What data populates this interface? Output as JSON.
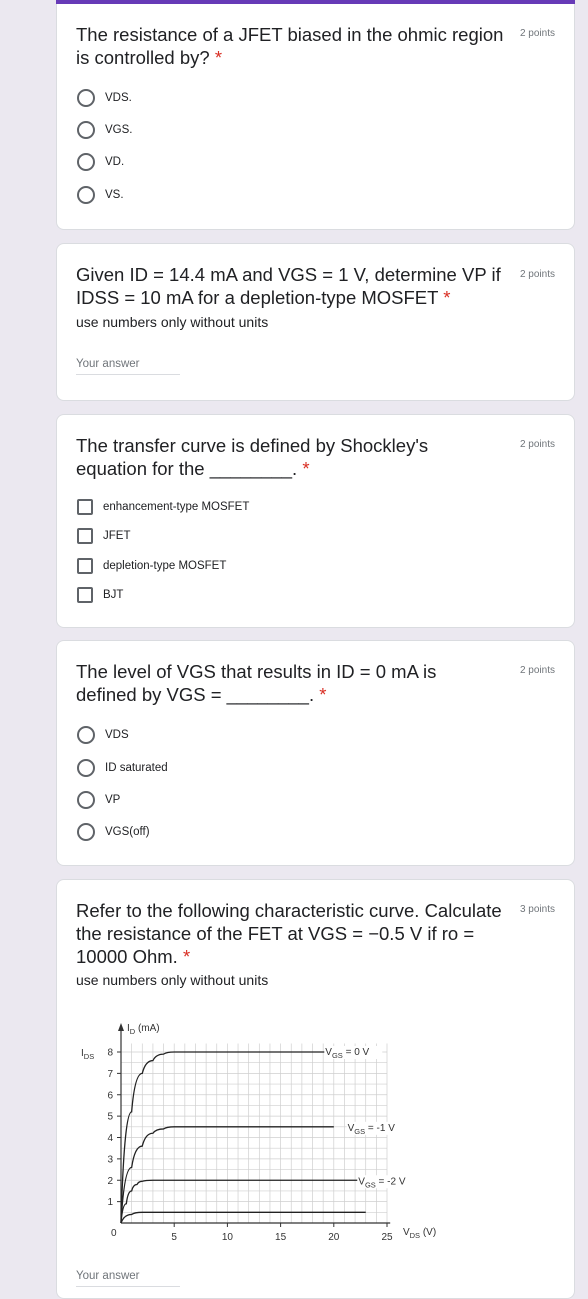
{
  "questions": [
    {
      "title": "The resistance of a JFET biased in the ohmic region is controlled by?",
      "required_mark": "*",
      "points": "2 points",
      "options": [
        "VDS.",
        "VGS.",
        "VD.",
        "VS."
      ]
    },
    {
      "title": "Given ID = 14.4 mA and VGS = 1 V, determine VP if IDSS = 10 mA for a depletion-type MOSFET",
      "required_mark": "*",
      "points": "2 points",
      "description": "use numbers only without units",
      "answer_placeholder": "Your answer"
    },
    {
      "title": "The transfer curve is defined by Shockley's equation for the ________.",
      "required_mark": "*",
      "points": "2 points",
      "options": [
        "enhancement-type MOSFET",
        "JFET",
        "depletion-type MOSFET",
        "BJT"
      ]
    },
    {
      "title": "The level of VGS that results in ID = 0 mA is defined by VGS = ________.",
      "required_mark": "*",
      "points": "2 points",
      "options": [
        "VDS",
        "ID saturated",
        "VP",
        "VGS(off)"
      ]
    },
    {
      "title": "Refer to the following characteristic curve. Calculate the resistance of the FET at VGS = −0.5 V if ro = 10000 Ohm.",
      "required_mark": "*",
      "points": "3 points",
      "description": "use numbers only without units",
      "answer_placeholder": "Your answer"
    }
  ],
  "figure": {
    "y_axis_label": "I",
    "y_axis_sub": "D",
    "y_axis_unit": " (mA)",
    "idss_label": "I",
    "idss_sub": "DS",
    "x_axis_label": "V",
    "x_axis_sub": "DS",
    "x_axis_unit": " (V)",
    "origin_label": "0",
    "y_ticks": [
      "1",
      "2",
      "3",
      "4",
      "5",
      "6",
      "7",
      "8"
    ],
    "x_ticks": [
      "5",
      "10",
      "15",
      "20",
      "25"
    ],
    "curve_labels": [
      {
        "pre": "V",
        "sub": "GS",
        "post": " = 0 V"
      },
      {
        "pre": "V",
        "sub": "GS",
        "post": " = -1 V"
      },
      {
        "pre": "V",
        "sub": "GS",
        "post": " = -2 V"
      }
    ]
  },
  "chart_data": {
    "type": "line",
    "xlabel": "VDS (V)",
    "ylabel": "ID (mA)",
    "xlim": [
      0,
      25
    ],
    "ylim": [
      0,
      8
    ],
    "series": [
      {
        "name": "VGS = 0 V",
        "x": [
          0,
          1,
          2,
          3,
          4,
          5,
          20
        ],
        "y": [
          0,
          5.2,
          7.0,
          7.6,
          7.9,
          8.0,
          8.0
        ]
      },
      {
        "name": "VGS = -1 V",
        "x": [
          0,
          1,
          2,
          3,
          4,
          5,
          20
        ],
        "y": [
          0,
          2.6,
          3.6,
          4.2,
          4.4,
          4.5,
          4.5
        ]
      },
      {
        "name": "VGS = -2 V",
        "x": [
          0,
          0.5,
          1,
          1.5,
          2,
          3,
          23
        ],
        "y": [
          0,
          0.9,
          1.5,
          1.8,
          1.95,
          2.0,
          2.0
        ]
      },
      {
        "name": "",
        "x": [
          0,
          1,
          2,
          3,
          23
        ],
        "y": [
          0,
          0.4,
          0.5,
          0.5,
          0.5
        ]
      }
    ]
  }
}
